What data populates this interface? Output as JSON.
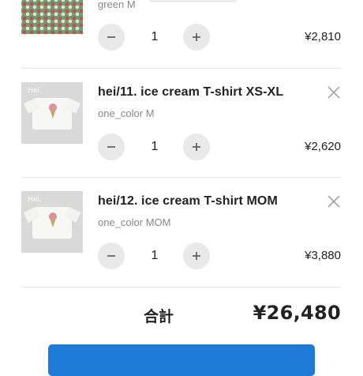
{
  "items": [
    {
      "title": "",
      "variant": "green M",
      "quantity": "1",
      "price": "¥2,810",
      "image": "green-pattern-tshirt-thumbnail"
    },
    {
      "title": "hei/11. ice cream T-shirt XS-XL",
      "variant": "one_color M",
      "quantity": "1",
      "price": "¥2,620",
      "image": "ice-cream-tshirt-thumbnail",
      "image_text": "Hei."
    },
    {
      "title": "hei/12. ice cream T-shirt MOM",
      "variant": "one_color MOM",
      "quantity": "1",
      "price": "¥3,880",
      "image": "ice-cream-tshirt-thumbnail",
      "image_text": "Hei."
    }
  ],
  "summary": {
    "total_label": "合計",
    "total_value": "¥26,480"
  },
  "colors": {
    "accent": "#1e7ad6",
    "stepper_bg": "#e9e9e9",
    "muted_text": "#888888",
    "divider": "#e6e6e6"
  },
  "icons": {
    "remove": "close-icon",
    "decrement": "minus-icon",
    "increment": "plus-icon"
  }
}
